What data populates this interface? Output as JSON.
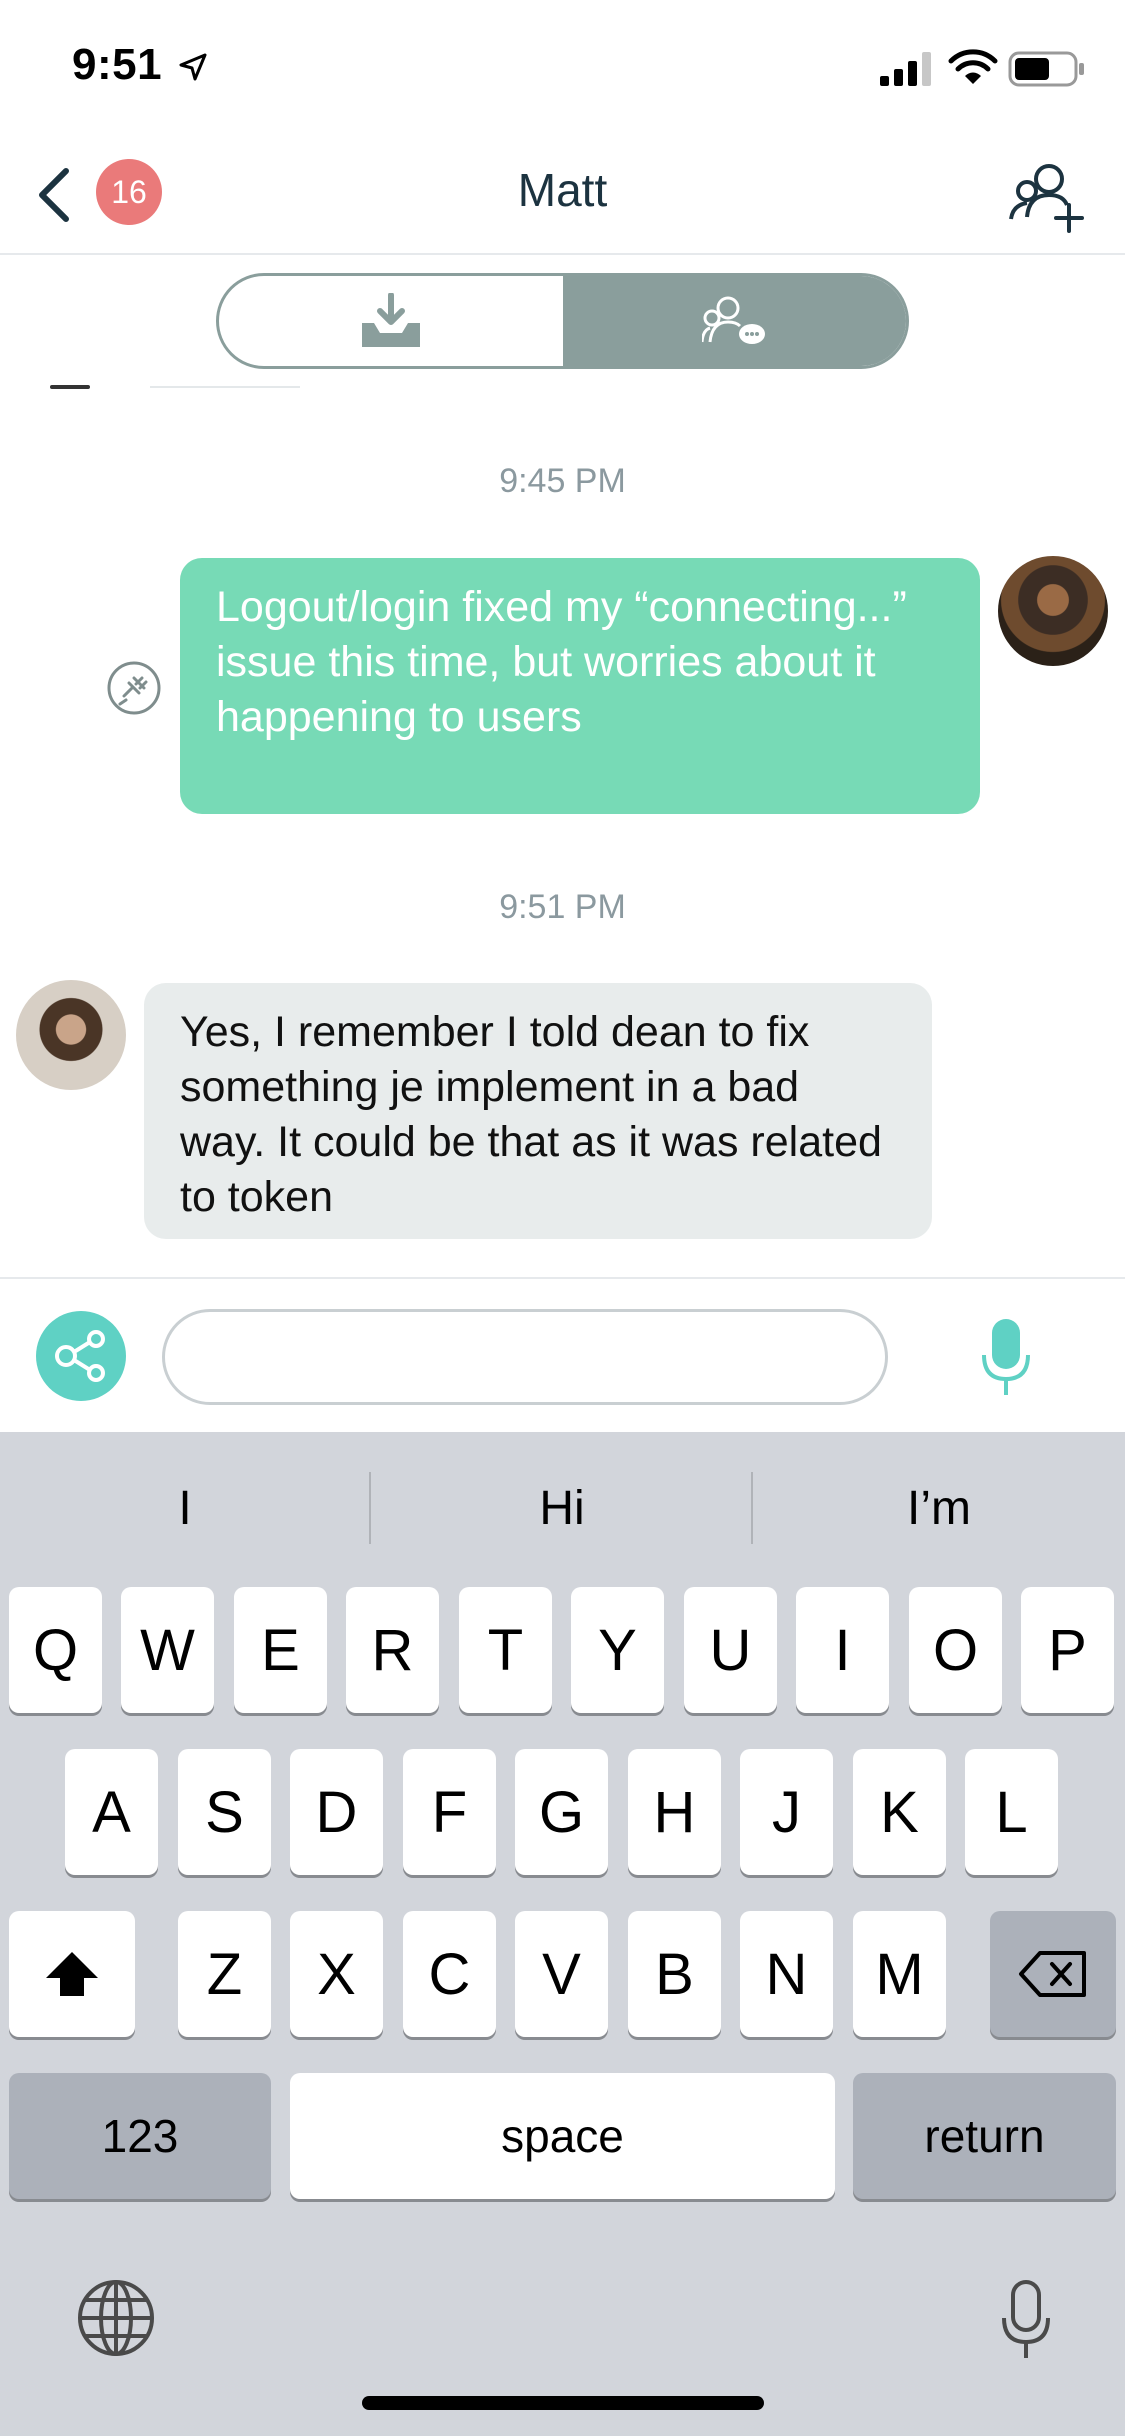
{
  "status_bar": {
    "time": "9:51"
  },
  "nav": {
    "badge_count": "16",
    "title": "Matt"
  },
  "messages": [
    {
      "timestamp": "9:45 PM",
      "direction": "outgoing",
      "text": "Logout/login fixed my “connecting...” issue this time, but worries about it happening to users"
    },
    {
      "timestamp": "9:51 PM",
      "direction": "incoming",
      "text": "Yes, I remember I told dean to fix something je implement in a bad way. It could be that as it was related to token"
    }
  ],
  "composer": {
    "value": ""
  },
  "keyboard": {
    "predictions": [
      "I",
      "Hi",
      "I’m"
    ],
    "row1": [
      "Q",
      "W",
      "E",
      "R",
      "T",
      "Y",
      "U",
      "I",
      "O",
      "P"
    ],
    "row2": [
      "A",
      "S",
      "D",
      "F",
      "G",
      "H",
      "J",
      "K",
      "L"
    ],
    "row3": [
      "Z",
      "X",
      "C",
      "V",
      "B",
      "N",
      "M"
    ],
    "numbers_label": "123",
    "space_label": "space",
    "return_label": "return"
  },
  "colors": {
    "outgoing_bubble": "#77dab6",
    "incoming_bubble": "#e8ecec",
    "badge": "#ea7a7a",
    "segment_active": "#8a9e9c",
    "accent_teal": "#5fd1c4"
  },
  "icons": {
    "back": "chevron-left-icon",
    "add_contact": "add-person-icon",
    "inbox": "inbox-download-icon",
    "group_chat": "group-chat-icon",
    "share": "share-nodes-icon",
    "mic": "microphone-icon",
    "globe": "globe-icon",
    "shift": "shift-arrow-icon",
    "delete": "backspace-icon"
  }
}
